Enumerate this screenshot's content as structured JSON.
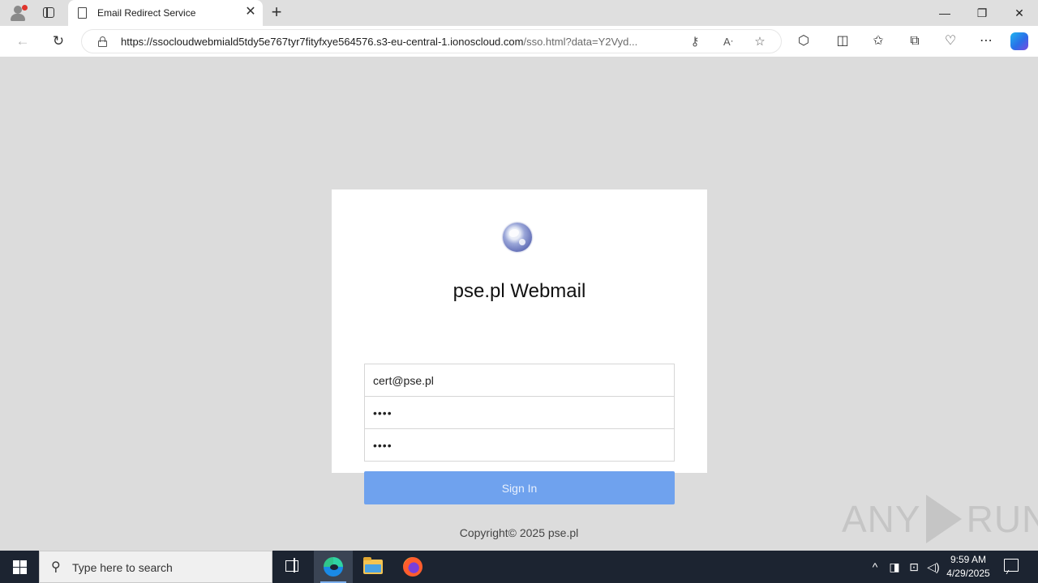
{
  "browser": {
    "tab": {
      "title": "Email Redirect Service",
      "close_glyph": "✕"
    },
    "new_tab_glyph": "+",
    "window_controls": {
      "minimize": "—",
      "maximize": "❐",
      "close": "✕"
    },
    "address": {
      "url_host": "https://ssocloudwebmiald5tdy5e767tyr7fityfxye564576.s3-eu-central-1.ionoscloud.com",
      "url_path": "/sso.html?data=Y2Vyd..."
    },
    "icons": [
      "back-icon",
      "refresh-icon",
      "lock-icon",
      "key-icon",
      "read-aloud-icon",
      "favorite-star-icon",
      "extensions-icon",
      "split-screen-icon",
      "favorites-icon",
      "collections-icon",
      "browser-essentials-icon",
      "more-icon",
      "copilot-icon"
    ]
  },
  "login": {
    "title": "pse.pl Webmail",
    "email_value": "cert@pse.pl",
    "password_value": "••••",
    "password2_value": "••••",
    "signin_label": "Sign In",
    "copyright": "Copyright© 2025 pse.pl"
  },
  "watermark": {
    "left": "ANY",
    "right": "RUN"
  },
  "taskbar": {
    "search_placeholder": "Type here to search",
    "time": "9:59 AM",
    "date": "4/29/2025"
  },
  "colors": {
    "signin_button": "#6fa2ee",
    "page_background": "#dcdcdc",
    "taskbar": "#1c2431"
  }
}
